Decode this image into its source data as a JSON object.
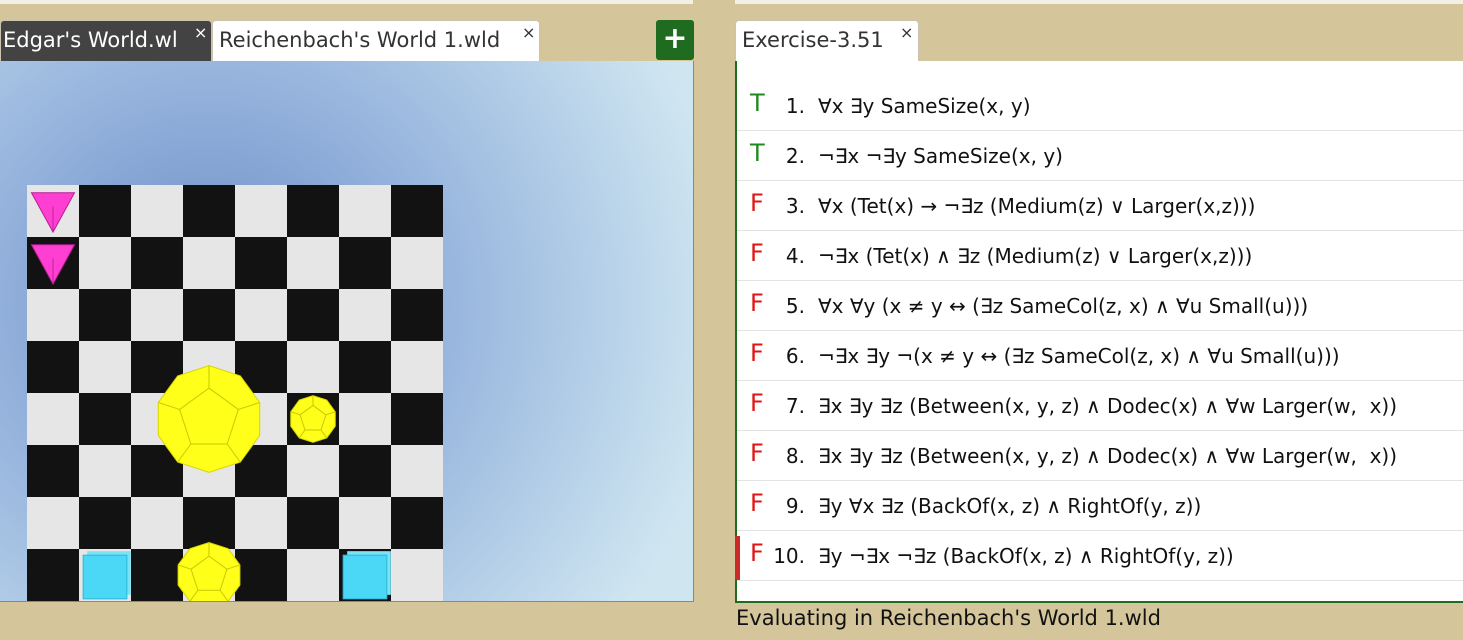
{
  "left_tabs": [
    {
      "label": "Edgar's World.wl",
      "active": false
    },
    {
      "label": "Reichenbach's World 1.wld",
      "active": true
    }
  ],
  "add_button_label": "+",
  "close_glyph": "×",
  "right_tab": {
    "label": "Exercise-3.51"
  },
  "board": {
    "size": 8,
    "light_color": "#e6e6e6",
    "dark_color": "#121212",
    "objects": [
      {
        "shape": "tet",
        "size": "small",
        "color": "#ff3fd1",
        "col": 0,
        "row": 0
      },
      {
        "shape": "tet",
        "size": "small",
        "color": "#ff3fd1",
        "col": 0,
        "row": 1
      },
      {
        "shape": "dodec",
        "size": "large",
        "color": "#ffff1a",
        "col": 3,
        "row": 4
      },
      {
        "shape": "dodec",
        "size": "small",
        "color": "#ffff1a",
        "col": 5,
        "row": 4
      },
      {
        "shape": "dodec",
        "size": "medium",
        "color": "#ffff1a",
        "col": 3,
        "row": 7
      },
      {
        "shape": "cube",
        "size": "small",
        "color": "#4ad8f6",
        "col": 1,
        "row": 7
      },
      {
        "shape": "cube",
        "size": "small",
        "color": "#4ad8f6",
        "col": 6,
        "row": 7
      }
    ]
  },
  "sentences": [
    {
      "num": "1.",
      "truth": "T",
      "text": "∀x ∃y SameSize(x, y)"
    },
    {
      "num": "2.",
      "truth": "T",
      "text": "¬∃x ¬∃y SameSize(x, y)"
    },
    {
      "num": "3.",
      "truth": "F",
      "text": "∀x (Tet(x) → ¬∃z (Medium(z) ∨ Larger(x,z)))"
    },
    {
      "num": "4.",
      "truth": "F",
      "text": "¬∃x (Tet(x) ∧ ∃z (Medium(z) ∨ Larger(x,z)))"
    },
    {
      "num": "5.",
      "truth": "F",
      "text": "∀x ∀y (x ≠ y ↔ (∃z SameCol(z, x) ∧ ∀u Small(u)))"
    },
    {
      "num": "6.",
      "truth": "F",
      "text": "¬∃x ∃y ¬(x ≠ y ↔ (∃z SameCol(z, x) ∧ ∀u Small(u)))"
    },
    {
      "num": "7.",
      "truth": "F",
      "text": "∃x ∃y ∃z (Between(x, y, z) ∧ Dodec(x) ∧ ∀w Larger(w,  x))"
    },
    {
      "num": "8.",
      "truth": "F",
      "text": "∃x ∃y ∃z (Between(x, y, z) ∧ Dodec(x) ∧ ∀w Larger(w,  x))"
    },
    {
      "num": "9.",
      "truth": "F",
      "text": "∃y ∀x ∃z (BackOf(x, z) ∧ RightOf(y, z))"
    },
    {
      "num": "10.",
      "truth": "F",
      "text": "∃y ¬∃x ¬∃z (BackOf(x, z) ∧ RightOf(y, z))",
      "current": true
    }
  ],
  "status": "Evaluating in Reichenbach's World 1.wld"
}
